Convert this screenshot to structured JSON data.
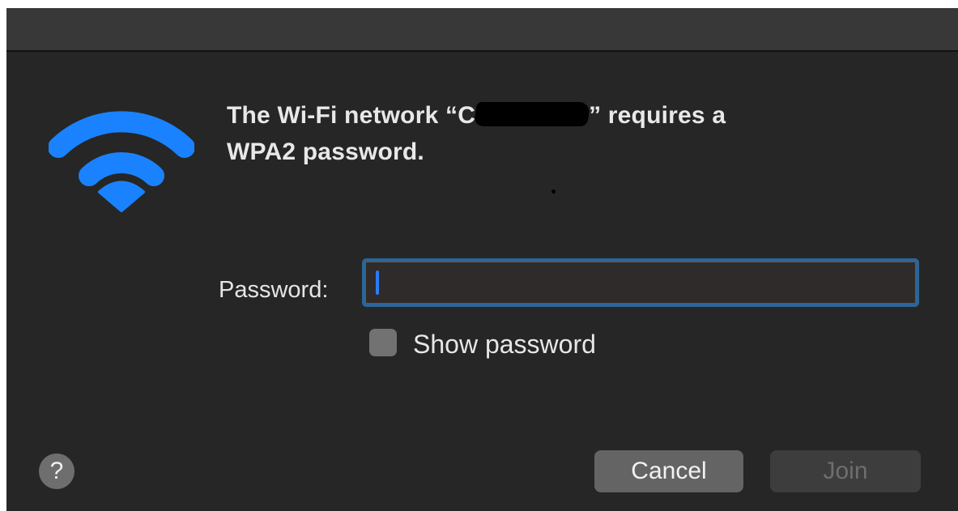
{
  "dialog": {
    "message_prefix": "The Wi-Fi network “C",
    "message_suffix": "” requires a",
    "message_line2": "WPA2 password.",
    "icon": "wifi-icon",
    "accent_color": "#1a82ff"
  },
  "form": {
    "password_label": "Password:",
    "password_value": "",
    "show_password_label": "Show password",
    "show_password_checked": false
  },
  "buttons": {
    "help_label": "?",
    "cancel_label": "Cancel",
    "join_label": "Join",
    "join_enabled": false
  }
}
